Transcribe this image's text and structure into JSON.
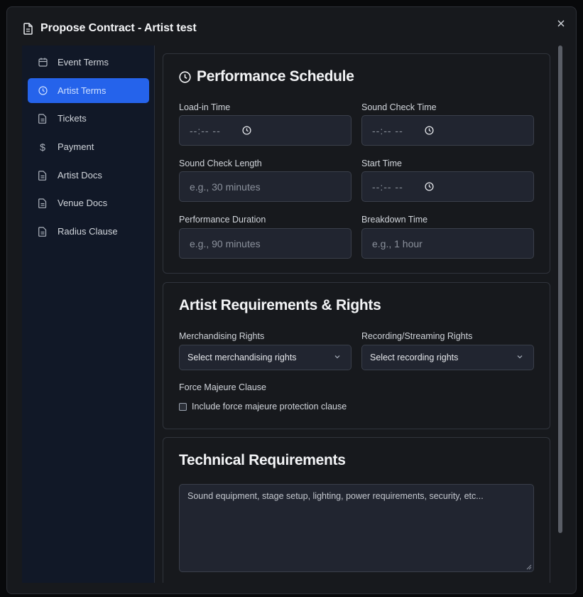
{
  "modal": {
    "title": "Propose Contract - Artist test",
    "close_label": "×"
  },
  "sidebar": {
    "items": [
      {
        "label": "Event Terms",
        "icon": "calendar-icon",
        "active": false
      },
      {
        "label": "Artist Terms",
        "icon": "clock-icon",
        "active": true
      },
      {
        "label": "Tickets",
        "icon": "document-icon",
        "active": false
      },
      {
        "label": "Payment",
        "icon": "dollar-icon",
        "active": false
      },
      {
        "label": "Artist Docs",
        "icon": "document-icon",
        "active": false
      },
      {
        "label": "Venue Docs",
        "icon": "document-icon",
        "active": false
      },
      {
        "label": "Radius Clause",
        "icon": "document-icon",
        "active": false
      }
    ]
  },
  "performance": {
    "title": "Performance Schedule",
    "load_in": {
      "label": "Load-in Time",
      "placeholder": "--:-- --"
    },
    "sound_check_time": {
      "label": "Sound Check Time",
      "placeholder": "--:-- --"
    },
    "sound_check_length": {
      "label": "Sound Check Length",
      "placeholder": "e.g., 30 minutes"
    },
    "start_time": {
      "label": "Start Time",
      "placeholder": "--:-- --"
    },
    "performance_duration": {
      "label": "Performance Duration",
      "placeholder": "e.g., 90 minutes"
    },
    "breakdown_time": {
      "label": "Breakdown Time",
      "placeholder": "e.g., 1 hour"
    }
  },
  "requirements": {
    "title": "Artist Requirements & Rights",
    "merch": {
      "label": "Merchandising Rights",
      "value": "Select merchandising rights"
    },
    "recording": {
      "label": "Recording/Streaming Rights",
      "value": "Select recording rights"
    },
    "force_majeure": {
      "label": "Force Majeure Clause",
      "checkbox_label": "Include force majeure protection clause",
      "checked": false
    }
  },
  "technical": {
    "title": "Technical Requirements",
    "placeholder": "Sound equipment, stage setup, lighting, power requirements, security, etc..."
  },
  "colors": {
    "accent": "#2563eb",
    "modal_bg": "#17191d",
    "sidebar_bg": "#111827",
    "input_bg": "#212530"
  }
}
